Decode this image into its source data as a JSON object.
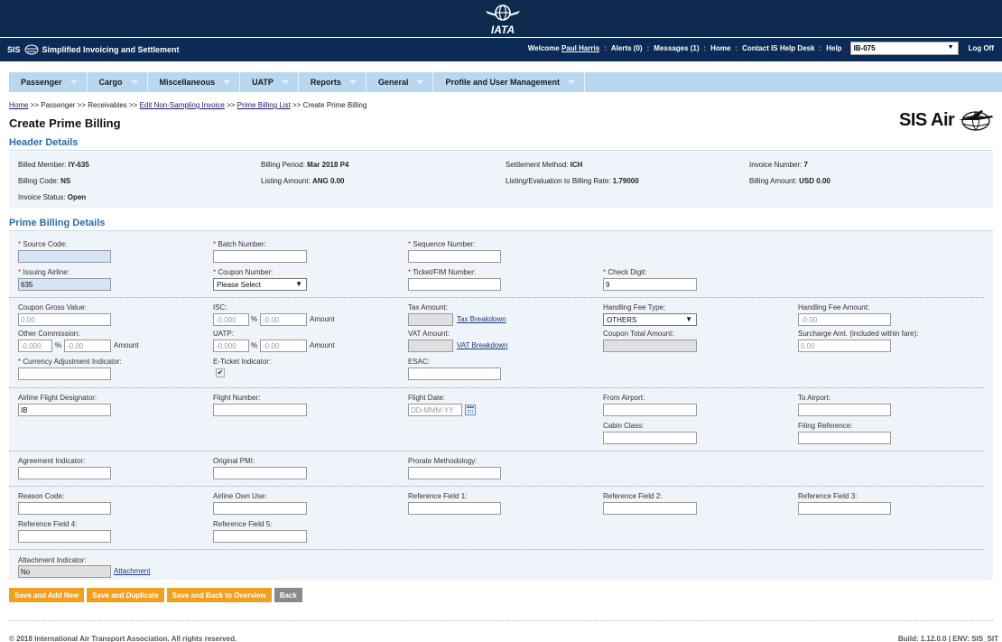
{
  "app": {
    "logo_text": "IATA",
    "title": "Simplified Invoicing and Settlement",
    "title_prefix": "SIS"
  },
  "top_links": {
    "welcome": "Welcome",
    "user": "Paul Harris",
    "alerts": "Alerts (0)",
    "messages": "Messages (1)",
    "home": "Home",
    "contact": "Contact IS Help Desk",
    "help": "Help",
    "member": "IB-075",
    "logoff": "Log Off"
  },
  "nav": [
    "Passenger",
    "Cargo",
    "Miscellaneous",
    "UATP",
    "Reports",
    "General",
    "Profile and User Management"
  ],
  "breadcrumb": {
    "home": "Home",
    "sep": " >> ",
    "passenger": "Passenger",
    "receivables": "Receivables",
    "edit_invoice": "Edit Non-Sampling Invoice",
    "prime_list": "Prime Billing List",
    "current": "Create Prime Billing"
  },
  "page_title": "Create Prime Billing",
  "brand_logo": "SIS Air",
  "header_details": {
    "title": "Header Details",
    "billed_member_label": "Billed Member:",
    "billed_member": "IY-635",
    "billing_period_label": "Billing Period:",
    "billing_period": "Mar 2018 P4",
    "settlement_label": "Settlement Method:",
    "settlement": "ICH",
    "invoice_number_label": "Invoice Number:",
    "invoice_number": "7",
    "billing_code_label": "Billing Code:",
    "billing_code": "NS",
    "listing_amount_label": "Listing Amount:",
    "listing_amount": "ANG 0.00",
    "rate_label": "Listing/Evaluation to Billing Rate:",
    "rate": "1.79000",
    "billing_amount_label": "Billing Amount:",
    "billing_amount": "USD 0.00",
    "status_label": "Invoice Status:",
    "status": "Open"
  },
  "prime": {
    "title": "Prime Billing Details",
    "req": "*",
    "source_code": {
      "label": "Source Code:",
      "value": ""
    },
    "batch_number": {
      "label": "Batch Number:",
      "value": ""
    },
    "sequence_number": {
      "label": "Sequence Number:",
      "value": ""
    },
    "issuing_airline": {
      "label": "Issuing Airline:",
      "value": "635"
    },
    "coupon_number": {
      "label": "Coupon Number:",
      "value": "Please Select"
    },
    "ticket_number": {
      "label": "Ticket/FIM Number:",
      "value": ""
    },
    "check_digit": {
      "label": "Check Digit:",
      "value": "9"
    },
    "coupon_gross": {
      "label": "Coupon Gross Value:",
      "value": "0.00"
    },
    "isc": {
      "label": "ISC:",
      "pct": "-0.000",
      "pct_sign": "%",
      "amount": "-0.00",
      "amount_label": "Amount"
    },
    "tax_amount": {
      "label": "Tax Amount:",
      "link": "Tax Breakdown"
    },
    "handling_fee_type": {
      "label": "Handling Fee Type:",
      "value": "OTHERS"
    },
    "handling_fee_amount": {
      "label": "Handling Fee Amount:",
      "value": "-0.00"
    },
    "other_commission": {
      "label": "Other Commission:",
      "pct": "-0.000",
      "pct_sign": "%",
      "amount": "-0.00",
      "amount_label": "Amount"
    },
    "uatp": {
      "label": "UATP:",
      "pct": "-0.000",
      "pct_sign": "%",
      "amount": "-0.00",
      "amount_label": "Amount"
    },
    "vat_amount": {
      "label": "VAT Amount:",
      "link": "VAT Breakdown"
    },
    "coupon_total": {
      "label": "Coupon Total Amount:"
    },
    "surcharge": {
      "label": "Surcharge Amt. (included within fare):",
      "value": "0.00"
    },
    "currency_adj": {
      "label": "Currency Adjustment Indicator:",
      "value": ""
    },
    "eticket": {
      "label": "E-Ticket Indicator:",
      "check": "✔"
    },
    "esac": {
      "label": "ESAC:",
      "value": ""
    },
    "flight_designator": {
      "label": "Airline Flight Designator:",
      "value": "IB"
    },
    "flight_number": {
      "label": "Flight Number:",
      "value": ""
    },
    "flight_date": {
      "label": "Flight Date:",
      "placeholder": "DD-MMM-YY"
    },
    "from_airport": {
      "label": "From Airport:",
      "value": ""
    },
    "to_airport": {
      "label": "To Airport:",
      "value": ""
    },
    "cabin_class": {
      "label": "Cabin Class:",
      "value": ""
    },
    "filing_reference": {
      "label": "Filing Reference:",
      "value": ""
    },
    "agreement": {
      "label": "Agreement Indicator:",
      "value": ""
    },
    "original_pmi": {
      "label": "Original PMI:",
      "value": ""
    },
    "prorate": {
      "label": "Prorate Methodology:",
      "value": ""
    },
    "reason_code": {
      "label": "Reason Code:",
      "value": ""
    },
    "airline_own_use": {
      "label": "Airline Own Use:",
      "value": ""
    },
    "ref1": {
      "label": "Reference Field 1:",
      "value": ""
    },
    "ref2": {
      "label": "Reference Field 2:",
      "value": ""
    },
    "ref3": {
      "label": "Reference Field 3:",
      "value": ""
    },
    "ref4": {
      "label": "Reference Field 4:",
      "value": ""
    },
    "ref5": {
      "label": "Reference Field 5:",
      "value": ""
    },
    "attachment": {
      "label": "Attachment Indicator:",
      "value": "No",
      "link": "Attachment"
    }
  },
  "buttons": {
    "save_add": "Save and Add New",
    "save_dup": "Save and Duplicate",
    "save_back": "Save and Back to Overview",
    "back": "Back"
  },
  "footer": {
    "copyright": "© 2018 International Air Transport Association. All rights reserved.",
    "build": "Build: 1.12.0.0 | ENV: SIS_SIT"
  },
  "colors": {
    "header": "#0d2a4c",
    "nav": "#b9d8f0",
    "accent": "#2b6aa6",
    "button": "#f0a020",
    "panel": "#eef4f9"
  }
}
